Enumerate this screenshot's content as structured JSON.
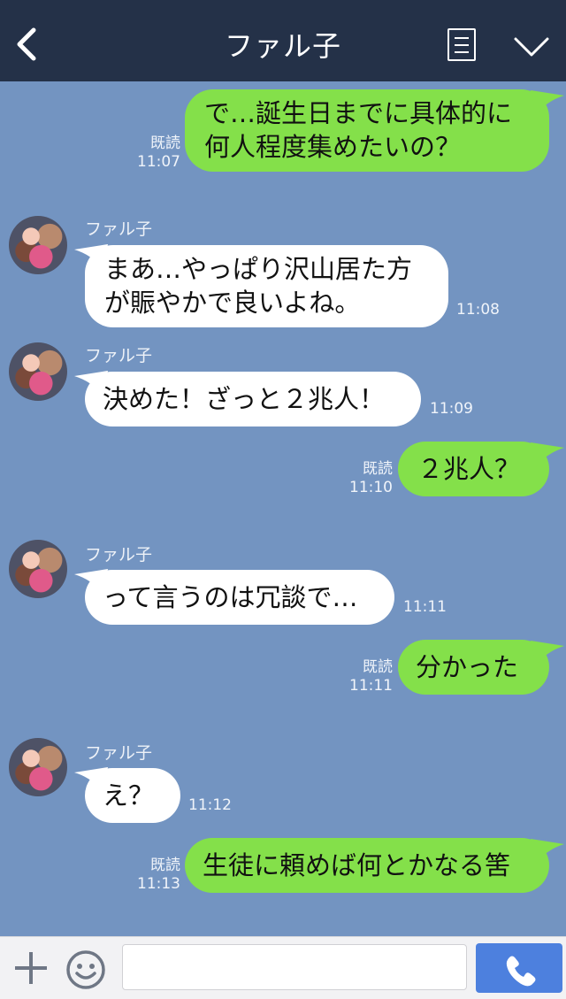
{
  "header": {
    "title": "ファル子"
  },
  "messages": [
    {
      "type": "out",
      "text": "で…誕生日までに具体的に\n何人程度集めたいの？",
      "read": "既読",
      "time": "11:07"
    },
    {
      "type": "in",
      "sender": "ファル子",
      "text": "まあ…やっぱり沢山居た方\nが賑やかで良いよね。",
      "time": "11:08"
    },
    {
      "type": "in",
      "sender": "ファル子",
      "text": "決めた！ざっと２兆人！",
      "time": "11:09"
    },
    {
      "type": "out",
      "text": "２兆人？",
      "read": "既読",
      "time": "11:10"
    },
    {
      "type": "in",
      "sender": "ファル子",
      "text": "って言うのは冗談で…",
      "time": "11:11"
    },
    {
      "type": "out",
      "text": "分かった",
      "read": "既読",
      "time": "11:11"
    },
    {
      "type": "in",
      "sender": "ファル子",
      "text": "え？",
      "time": "11:12"
    },
    {
      "type": "out",
      "text": "生徒に頼めば何とかなる筈",
      "read": "既読",
      "time": "11:13"
    }
  ],
  "colors": {
    "header_bg": "#243148",
    "chat_bg": "#7394c1",
    "outgoing_bubble": "#84e04a",
    "incoming_bubble": "#ffffff",
    "send_button": "#4d80de"
  },
  "icons": [
    "back-chevron-icon",
    "menu-icon",
    "chevron-down-icon",
    "plus-icon",
    "emoji-icon",
    "phone-icon"
  ],
  "input": {
    "value": "",
    "placeholder": ""
  }
}
